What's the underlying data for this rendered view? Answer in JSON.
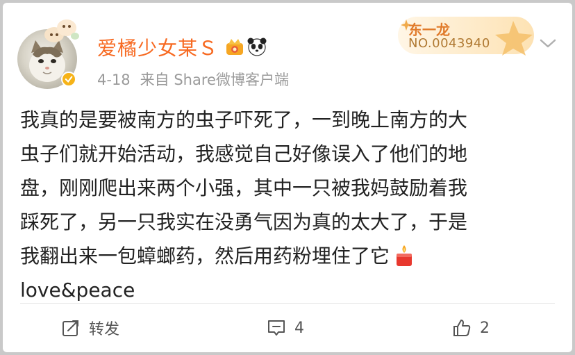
{
  "post": {
    "username": "爱橘少女某Ｓ",
    "date": "4-18",
    "source": "来自 Share微博客户端",
    "fan_badge": {
      "title": "东一龙",
      "number": "NO.0043940"
    },
    "content_lines": [
      "我真的是要被南方的虫子吓死了，一到晚上南方的大",
      "虫子们就开始活动，我感觉自己好像误入了他们的地",
      "盘，刚刚爬出来两个小强，其中一只被我妈鼓励着我",
      "踩死了，另一只我实在没勇气因为真的太大了，于是",
      "我翻出来一包蟑螂药，然后用药粉埋住了它",
      "love&peace"
    ],
    "emoji": "candle-emoji",
    "actions": {
      "repost_label": "转发",
      "comment_count": "4",
      "like_count": "2"
    }
  },
  "colors": {
    "username": "#f76a22",
    "meta": "#9a9a9a",
    "text": "#222222",
    "verified": "#f6b318"
  }
}
